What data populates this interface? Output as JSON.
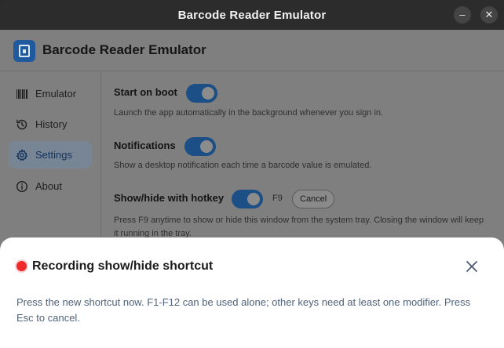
{
  "window": {
    "title": "Barcode Reader Emulator",
    "minimize_glyph": "–",
    "close_glyph": "✕"
  },
  "app": {
    "title": "Barcode Reader Emulator",
    "logo_icon": "barcode-scanner-icon"
  },
  "sidebar": {
    "items": [
      {
        "label": "Emulator",
        "icon": "barcode-icon"
      },
      {
        "label": "History",
        "icon": "history-icon"
      },
      {
        "label": "Settings",
        "icon": "gear-icon",
        "active": true
      },
      {
        "label": "About",
        "icon": "info-icon"
      }
    ]
  },
  "settings": {
    "start_on_boot": {
      "label": "Start on boot",
      "description": "Launch the app automatically in the background whenever you sign in.",
      "enabled": true
    },
    "notifications": {
      "label": "Notifications",
      "description": "Show a desktop notification each time a barcode value is emulated.",
      "enabled": true
    },
    "hotkey": {
      "label": "Show/hide with hotkey",
      "key": "F9",
      "cancel_label": "Cancel",
      "description": "Press F9 anytime to show or hide this window from the system tray. Closing the window will keep it running in the tray.",
      "enabled": true
    }
  },
  "dialog": {
    "title": "Recording show/hide shortcut",
    "body": "Press the new shortcut now. F1-F12 can be used alone; other keys need at least one modifier. Press Esc to cancel.",
    "status_color": "#ee2a2a"
  },
  "colors": {
    "accent": "#1b4f86",
    "overlay": "#7f7f80",
    "recording": "#ee2a2a"
  }
}
